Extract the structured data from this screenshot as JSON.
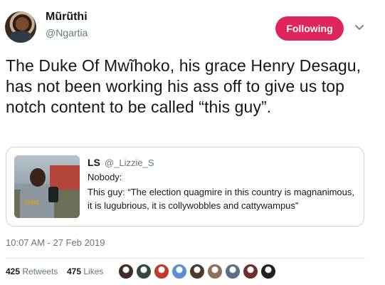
{
  "user": {
    "name": "Mũrũthi",
    "handle": "@Ngartia",
    "follow_label": "Following"
  },
  "tweet": {
    "text": "The Duke Of Mwĩhoko, his grace Henry Desagu, has not been working his ass off to give us top notch content to be called “this guy”."
  },
  "quoted": {
    "name": "LS",
    "handle": "@_Lizzie_S",
    "line1": "Nobody:",
    "line2": "This guy: “The election quagmire in this country is magnanimous, it is lugubrious, it is collywobbles and cattywampus”",
    "thumb_logo_text": "GIAN"
  },
  "meta": {
    "timestamp": "10:07 AM - 27 Feb 2019"
  },
  "stats": {
    "retweets_count": "425",
    "retweets_label": "Retweets",
    "likes_count": "475",
    "likes_label": "Likes"
  },
  "colors": {
    "follow_button": "#e0245e",
    "secondary_text": "#657786",
    "border": "#ccd6dd"
  },
  "likers": [
    {
      "color": "#3d2b24"
    },
    {
      "color": "#2f4a3a"
    },
    {
      "color": "#c0392b"
    },
    {
      "color": "#5b8fd1"
    },
    {
      "color": "#4a3b2f"
    },
    {
      "color": "#8e6f5a"
    },
    {
      "color": "#5a6e86"
    },
    {
      "color": "#6b2e2e"
    },
    {
      "color": "#1f1f24"
    }
  ]
}
